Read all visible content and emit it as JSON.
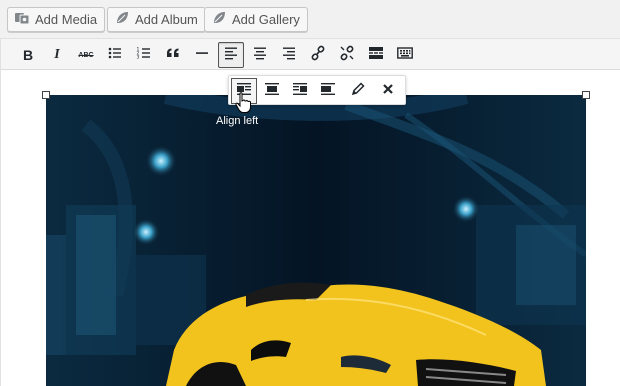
{
  "media_buttons": [
    {
      "label": "Add Media",
      "icon": "media-icon"
    },
    {
      "label": "Add Album",
      "icon": "leaf-icon"
    },
    {
      "label": "Add Gallery",
      "icon": "leaf-icon"
    }
  ],
  "toolbar": {
    "bold": "B",
    "italic": "I",
    "strikethrough": "ABC",
    "buttons": [
      "bold",
      "italic",
      "strikethrough",
      "bulleted-list",
      "numbered-list",
      "blockquote",
      "horizontal-line",
      "align-left",
      "align-center",
      "align-right",
      "insert-link",
      "remove-link",
      "read-more",
      "toolbar-toggle"
    ],
    "active": "align-left"
  },
  "image_toolbar": {
    "buttons": [
      "align-left",
      "align-center",
      "align-right",
      "no-alignment",
      "edit",
      "remove"
    ],
    "active": "align-left"
  },
  "tooltip": "Align left",
  "image": {
    "subject": "yellow sports car in dark tunnel",
    "colors": [
      "#061a2c",
      "#1e5a7a",
      "#f2c21d"
    ]
  }
}
